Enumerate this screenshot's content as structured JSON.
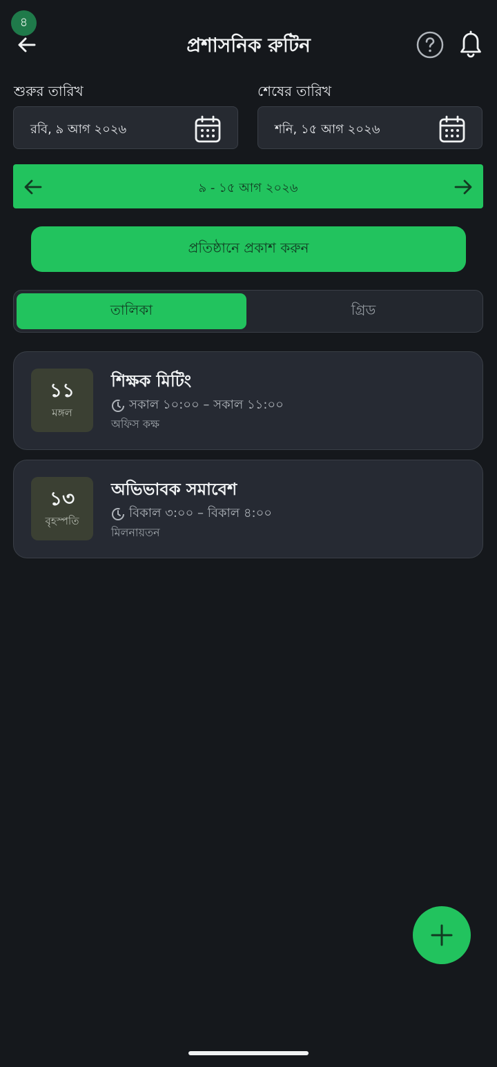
{
  "status": {
    "badge_count": "৪"
  },
  "header": {
    "title": "প্রশাসনিক রুটিন",
    "back_icon": "arrow-left-icon",
    "help_icon": "help-circle-icon",
    "bell_icon": "bell-icon"
  },
  "dates": {
    "start_label": "শুরুর তারিখ",
    "start_value": "রবি, ৯ আগ ২০২৬",
    "end_label": "শেষের তারিখ",
    "end_value": "শনি, ১৫ আগ ২০২৬"
  },
  "week_nav": {
    "range": "৯ - ১৫ আগ ২০২৬"
  },
  "publish_button": "প্রতিষ্ঠানে প্রকাশ করুন",
  "view_toggle": {
    "list": "তালিকা",
    "grid": "গ্রিড",
    "selected": "list"
  },
  "events": [
    {
      "day": "১১",
      "weekday": "মঙ্গল",
      "title": "শিক্ষক মিটিং",
      "time": "সকাল ১০:০০ – সকাল ১১:০০",
      "location": "অফিস কক্ষ"
    },
    {
      "day": "১৩",
      "weekday": "বৃহস্পতি",
      "title": "অভিভাবক সমাবেশ",
      "time": "বিকাল ৩:০০ – বিকাল ৪:০০",
      "location": "মিলনায়তন"
    }
  ],
  "colors": {
    "accent": "#22c35e",
    "background": "#15181c",
    "card": "#262a33"
  }
}
